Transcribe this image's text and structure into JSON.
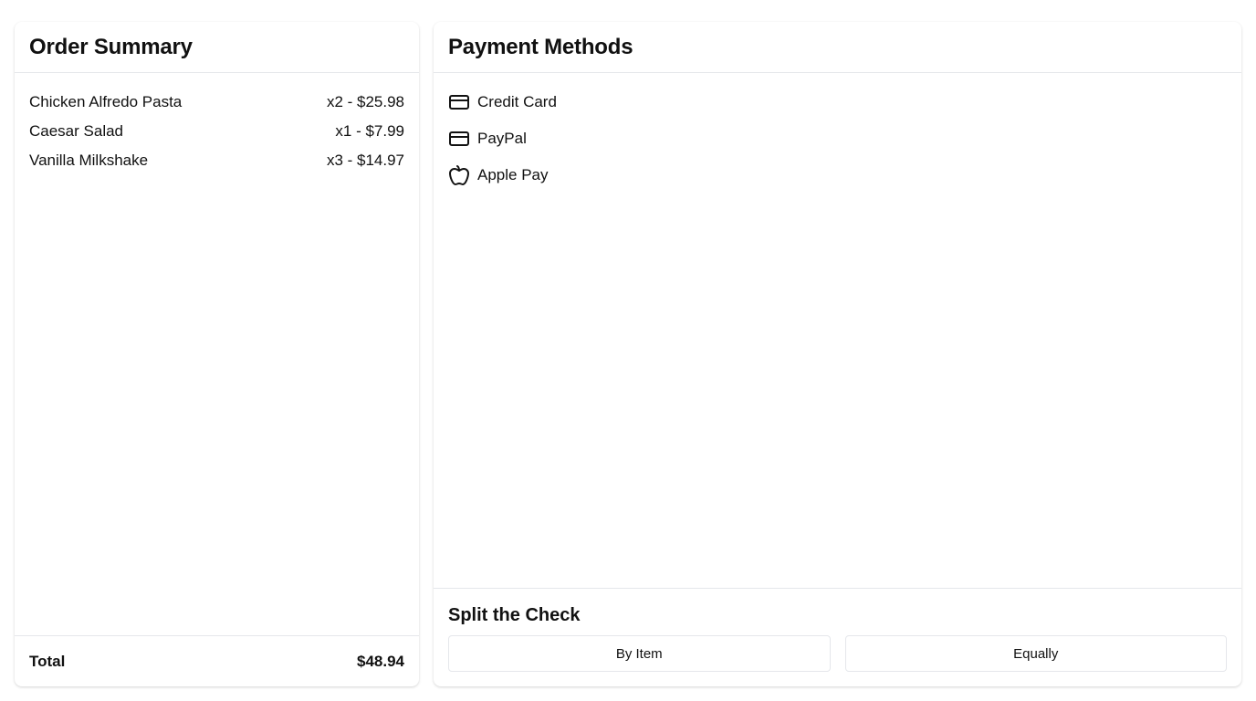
{
  "order_summary": {
    "title": "Order Summary",
    "items": [
      {
        "name": "Chicken Alfredo Pasta",
        "detail": "x2 - $25.98"
      },
      {
        "name": "Caesar Salad",
        "detail": "x1 - $7.99"
      },
      {
        "name": "Vanilla Milkshake",
        "detail": "x3 - $14.97"
      }
    ],
    "total_label": "Total",
    "total_value": "$48.94"
  },
  "payment_methods": {
    "title": "Payment Methods",
    "methods": [
      {
        "label": "Credit Card",
        "icon": "credit-card-icon"
      },
      {
        "label": "PayPal",
        "icon": "credit-card-icon"
      },
      {
        "label": "Apple Pay",
        "icon": "apple-icon"
      }
    ]
  },
  "split_check": {
    "title": "Split the Check",
    "by_item_label": "By Item",
    "equally_label": "Equally"
  },
  "colors": {
    "border": "#e5e7eb",
    "text": "#111111",
    "background": "#ffffff"
  }
}
